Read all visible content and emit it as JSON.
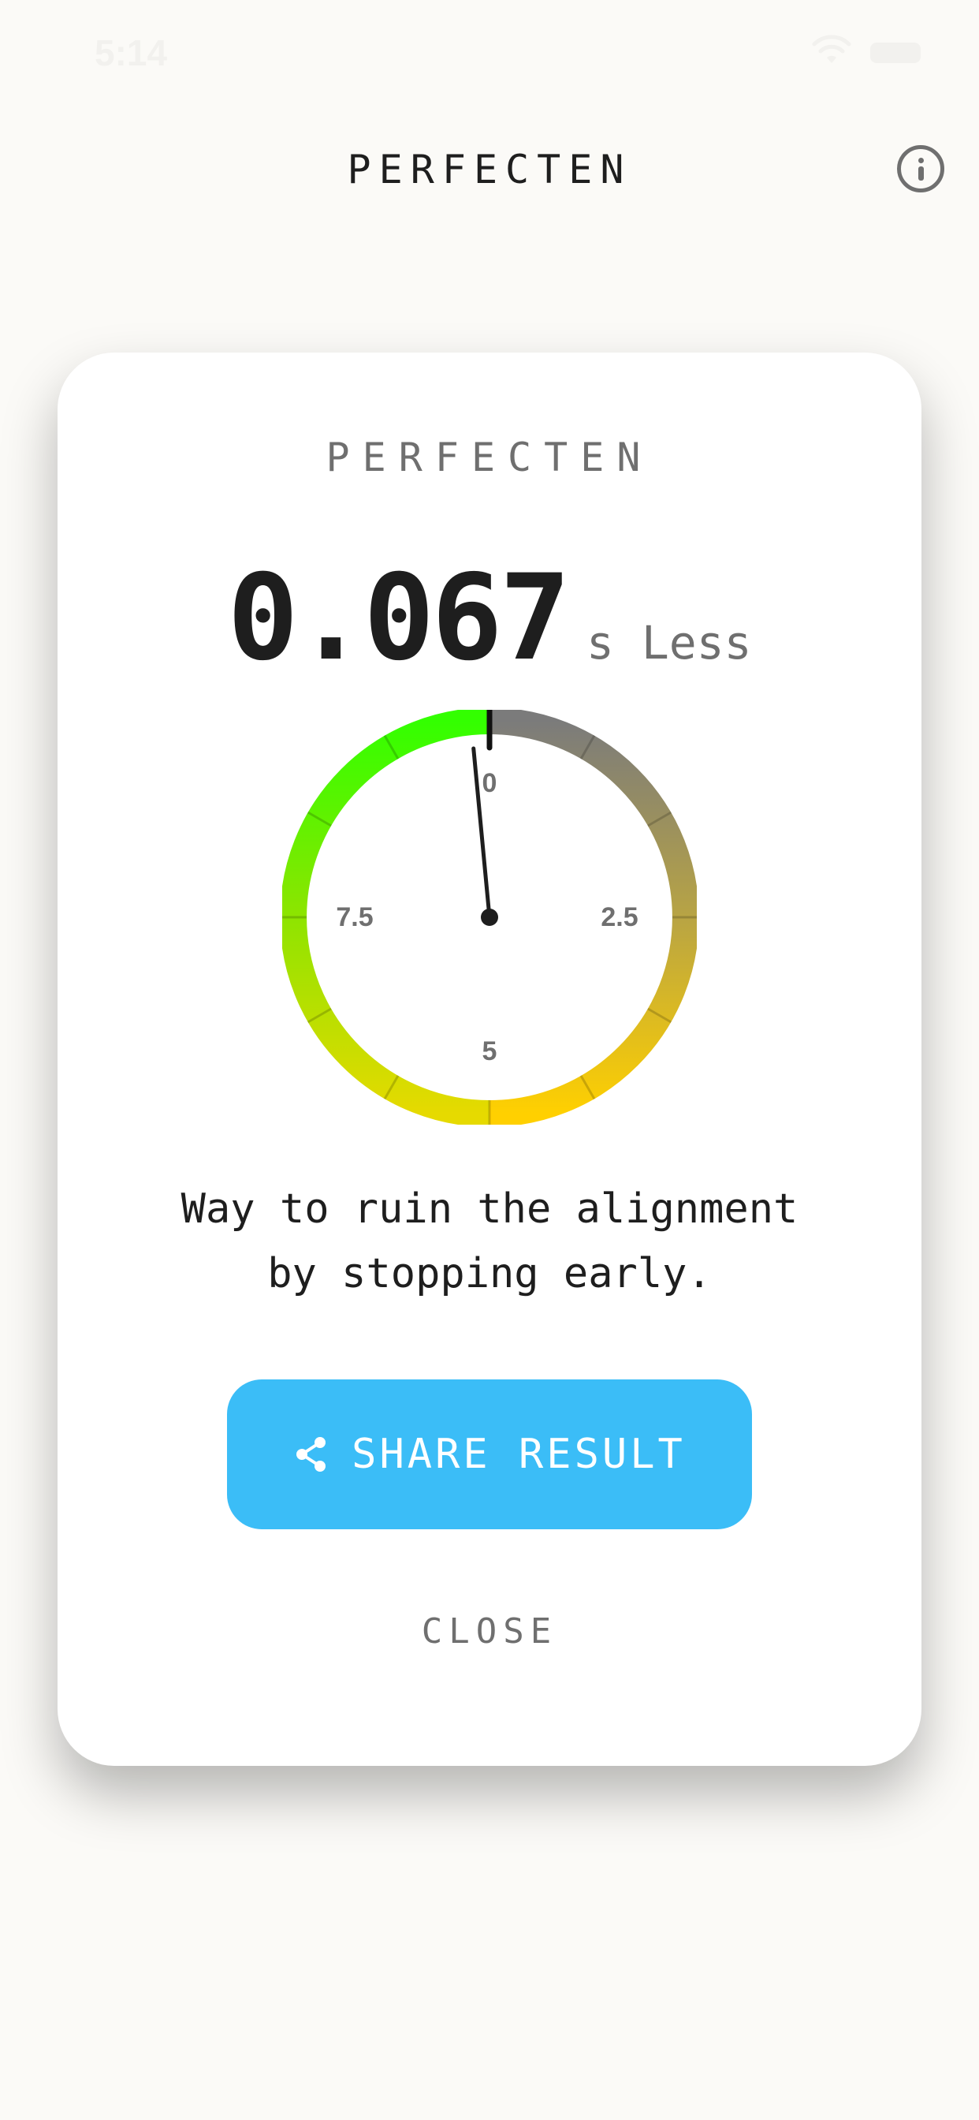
{
  "status_bar": {
    "time": "5:14"
  },
  "header": {
    "title": "PERFECTEN",
    "info_icon": "info-icon"
  },
  "card": {
    "title": "PERFECTEN",
    "result": {
      "value": "0.067",
      "unit": "s Less"
    },
    "gauge": {
      "labels": [
        "0",
        "2.5",
        "5",
        "7.5"
      ],
      "needle_value": 0.067,
      "max": 10,
      "colors": {
        "green": "#33ff00",
        "yellow_green": "#b5e000",
        "yellow": "#ffd000",
        "olive": "#a8a050",
        "gray": "#7b7b7b"
      }
    },
    "message_line1": "Way to ruin the alignment",
    "message_line2": "by stopping early.",
    "share_button": {
      "label": "SHARE RESULT",
      "icon": "share-icon"
    },
    "close_button": {
      "label": "CLOSE"
    }
  },
  "colors": {
    "background": "#fbfaf7",
    "card": "#ffffff",
    "accent": "#3bbdf7",
    "text": "#1e1e1e",
    "muted": "#6f6f6f"
  }
}
